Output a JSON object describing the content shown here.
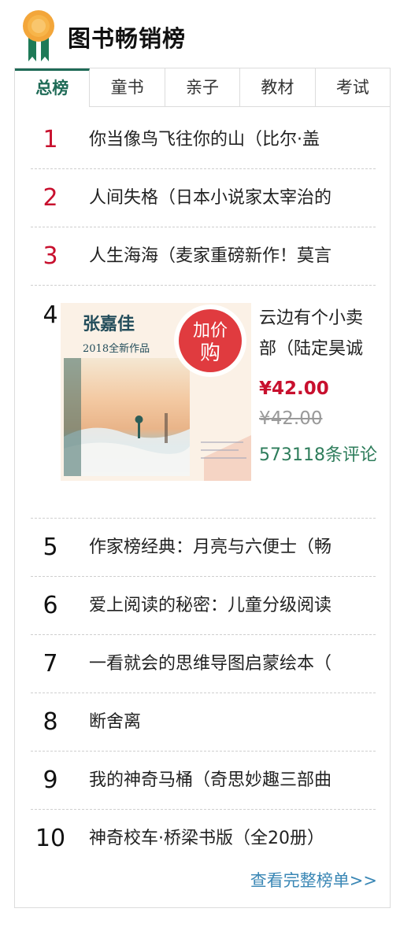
{
  "header": {
    "title": "图书畅销榜"
  },
  "tabs": [
    {
      "label": "总榜",
      "active": true
    },
    {
      "label": "童书",
      "active": false
    },
    {
      "label": "亲子",
      "active": false
    },
    {
      "label": "教材",
      "active": false
    },
    {
      "label": "考试",
      "active": false
    }
  ],
  "list_top": [
    {
      "rank": "1",
      "title": "你当像鸟飞往你的山（比尔·盖"
    },
    {
      "rank": "2",
      "title": "人间失格（日本小说家太宰治的"
    },
    {
      "rank": "3",
      "title": "人生海海（麦家重磅新作！莫言"
    }
  ],
  "featured": {
    "rank": "4",
    "title": "云边有个小卖部（陆定昊诚",
    "price": "¥42.00",
    "original_price": "¥42.00",
    "reviews": "573118条评论",
    "cover": {
      "author": "张嘉佳",
      "subtitle": "2018全新作品",
      "promo_line1": "加价",
      "promo_line2": "购"
    }
  },
  "list_bottom": [
    {
      "rank": "5",
      "title": "作家榜经典：月亮与六便士（畅"
    },
    {
      "rank": "6",
      "title": "爱上阅读的秘密：儿童分级阅读"
    },
    {
      "rank": "7",
      "title": "一看就会的思维导图启蒙绘本（"
    },
    {
      "rank": "8",
      "title": "断舍离"
    },
    {
      "rank": "9",
      "title": "我的神奇马桶（奇思妙趣三部曲"
    },
    {
      "rank": "10",
      "title": "神奇校车·桥梁书版（全20册）"
    }
  ],
  "footer": {
    "more_link": "查看完整榜单>>"
  },
  "colors": {
    "accent": "#1f6b57",
    "rank_top": "#c8102e",
    "price": "#c8102e",
    "reviews": "#2e7d5b",
    "link": "#3a87b5"
  },
  "icons": {
    "badge": "award-ribbon-icon"
  }
}
